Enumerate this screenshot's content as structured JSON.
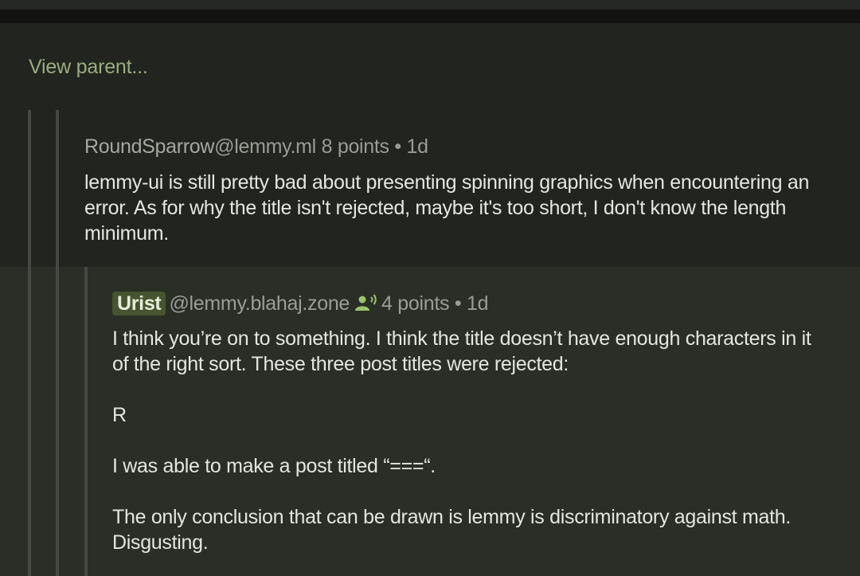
{
  "thread": {
    "view_parent_label": "View parent..."
  },
  "comment_1": {
    "user": "RoundSparrow",
    "instance": "@lemmy.ml",
    "points": "8 points",
    "separator": "•",
    "age": "1d",
    "body": "lemmy-ui is still pretty bad about presenting spinning graphics when encountering an error. As for why the title isn't rejected, maybe it's too short, I don't know the length minimum."
  },
  "comment_2": {
    "user": "Urist",
    "instance": "@lemmy.blahaj.zone",
    "user_icon": "person-speaking-icon",
    "points": "4 points",
    "separator": "•",
    "age": "1d",
    "paragraphs": [
      "I think you’re on to something. I think the title doesn’t have enough characters in it of the right sort. These three post titles were rejected:",
      "R",
      "I was able to make a post titled “===“.",
      "The only conclusion that can be drawn is lemmy is discriminatory against math. Disgusting."
    ]
  },
  "colors": {
    "accent_green": "#99ad80",
    "badge_bg": "#46542f",
    "background": "#22241f",
    "reply_background": "#2b2e27",
    "text": "#e4e6e1",
    "meta_text": "#9a9d96"
  }
}
